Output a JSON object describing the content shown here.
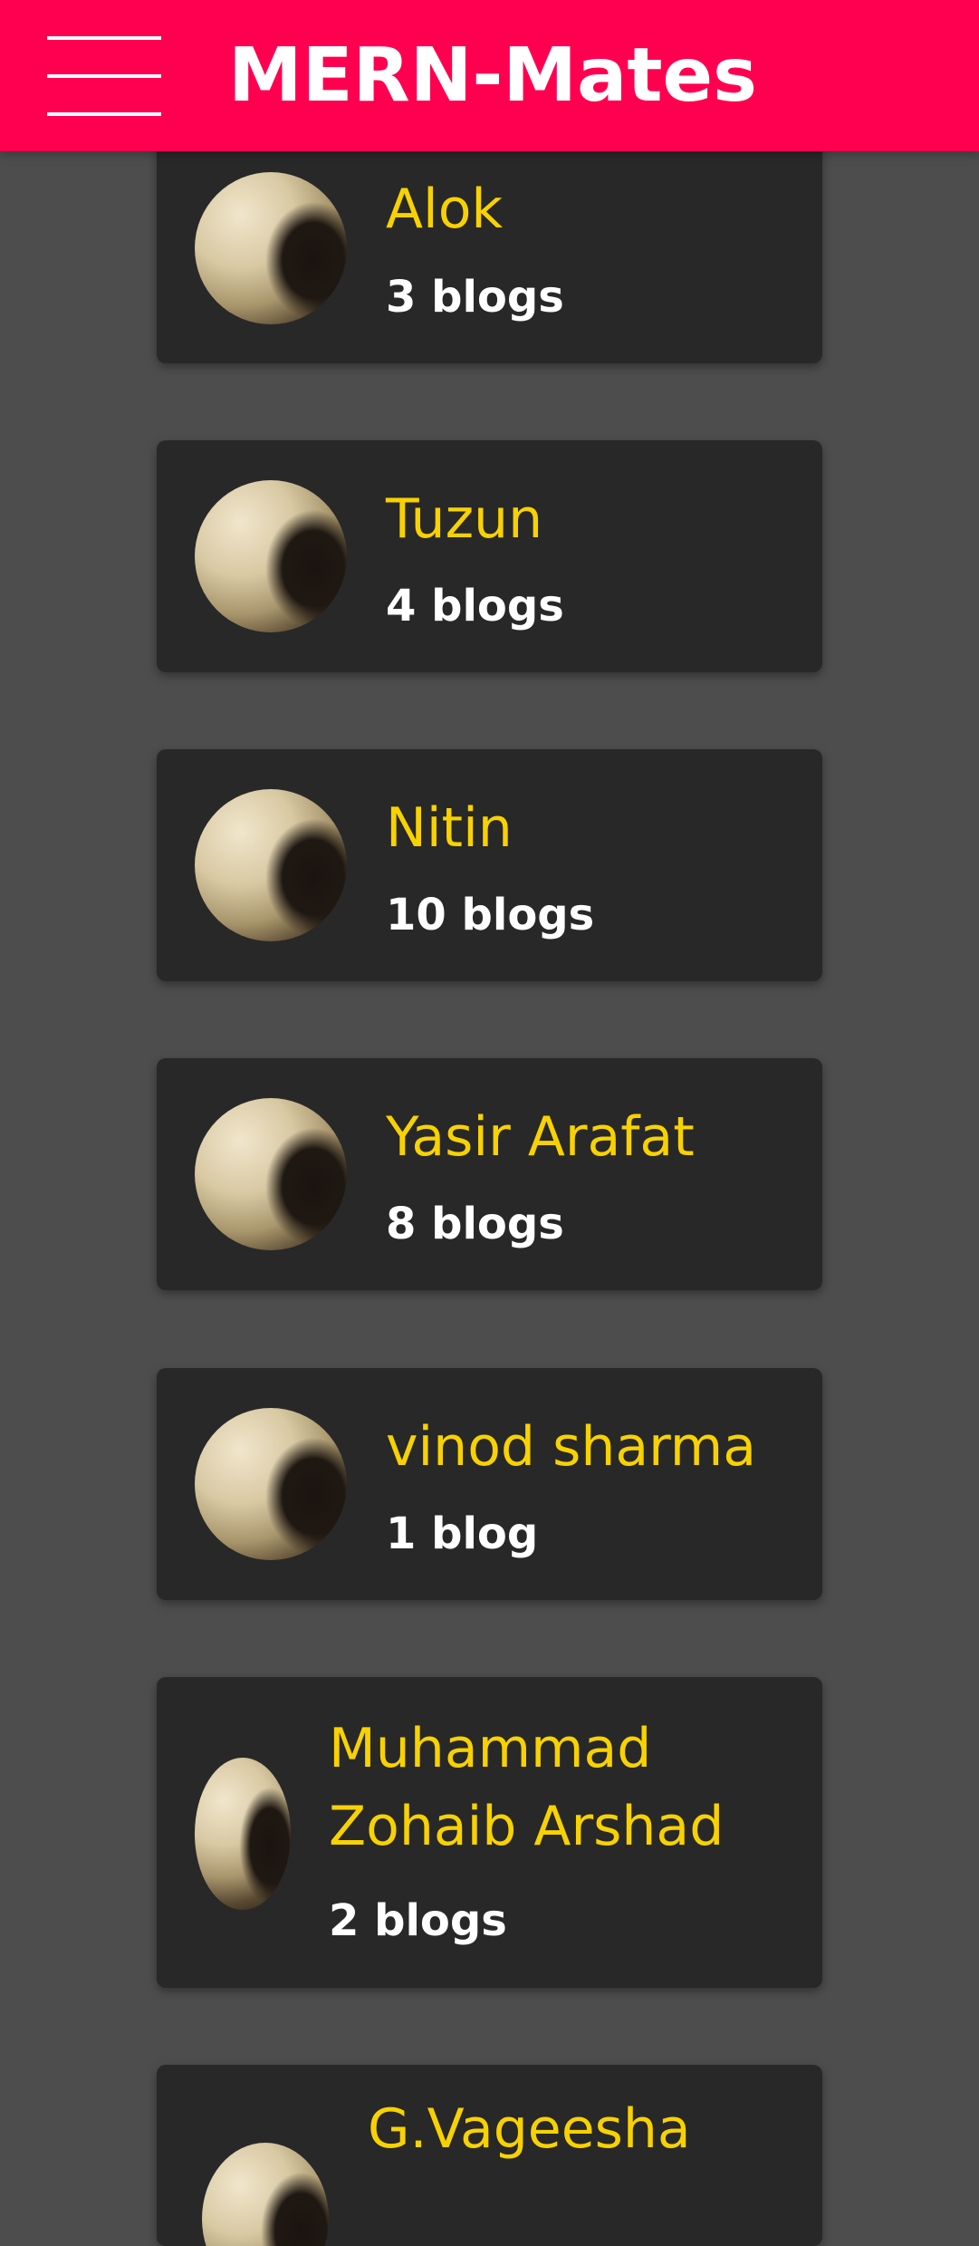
{
  "header": {
    "title": "MERN-Mates",
    "menu_icon": "hamburger-menu-icon",
    "background_color": "#ff0050"
  },
  "colors": {
    "page_background": "#4d4d4d",
    "card_background": "#282828",
    "name_color": "#f8d200",
    "count_color": "#ffffff"
  },
  "users": [
    {
      "name": "Alok",
      "blog_count": "3 blogs"
    },
    {
      "name": "Tuzun",
      "blog_count": "4 blogs"
    },
    {
      "name": "Nitin",
      "blog_count": "10 blogs"
    },
    {
      "name": "Yasir Arafat",
      "blog_count": "8 blogs"
    },
    {
      "name": "vinod sharma",
      "blog_count": "1 blog"
    },
    {
      "name": "Muhammad Zohaib Arshad",
      "blog_count": "2 blogs"
    },
    {
      "name": "G.Vageesha",
      "blog_count": ""
    }
  ]
}
